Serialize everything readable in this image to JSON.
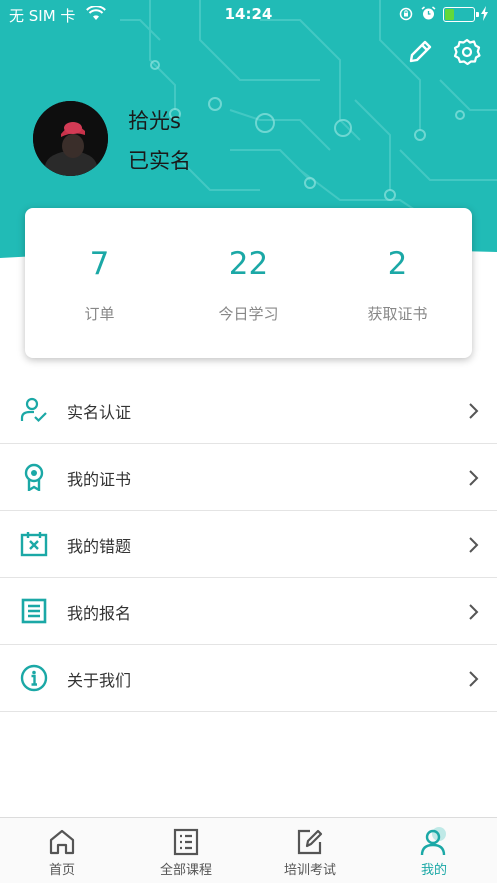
{
  "status_bar": {
    "carrier": "无 SIM 卡",
    "time": "14:24",
    "battery_level": 0.3
  },
  "profile": {
    "username": "拾光s",
    "verify_status": "已实名"
  },
  "stats": [
    {
      "value": "7",
      "label": "订单"
    },
    {
      "value": "22",
      "label": "今日学习"
    },
    {
      "value": "2",
      "label": "获取证书"
    }
  ],
  "menu": [
    {
      "label": "实名认证",
      "icon": "user-check-icon"
    },
    {
      "label": "我的证书",
      "icon": "certificate-icon"
    },
    {
      "label": "我的错题",
      "icon": "wrong-questions-icon"
    },
    {
      "label": "我的报名",
      "icon": "registration-icon"
    },
    {
      "label": "关于我们",
      "icon": "info-icon"
    }
  ],
  "tabs": [
    {
      "label": "首页",
      "icon": "home-icon",
      "active": false
    },
    {
      "label": "全部课程",
      "icon": "list-icon",
      "active": false
    },
    {
      "label": "培训考试",
      "icon": "edit-icon",
      "active": false
    },
    {
      "label": "我的",
      "icon": "user-icon",
      "active": true
    }
  ],
  "colors": {
    "brand": "#1ba8a6",
    "header_bg": "#21bbb6",
    "text": "#333333",
    "muted": "#888888"
  }
}
